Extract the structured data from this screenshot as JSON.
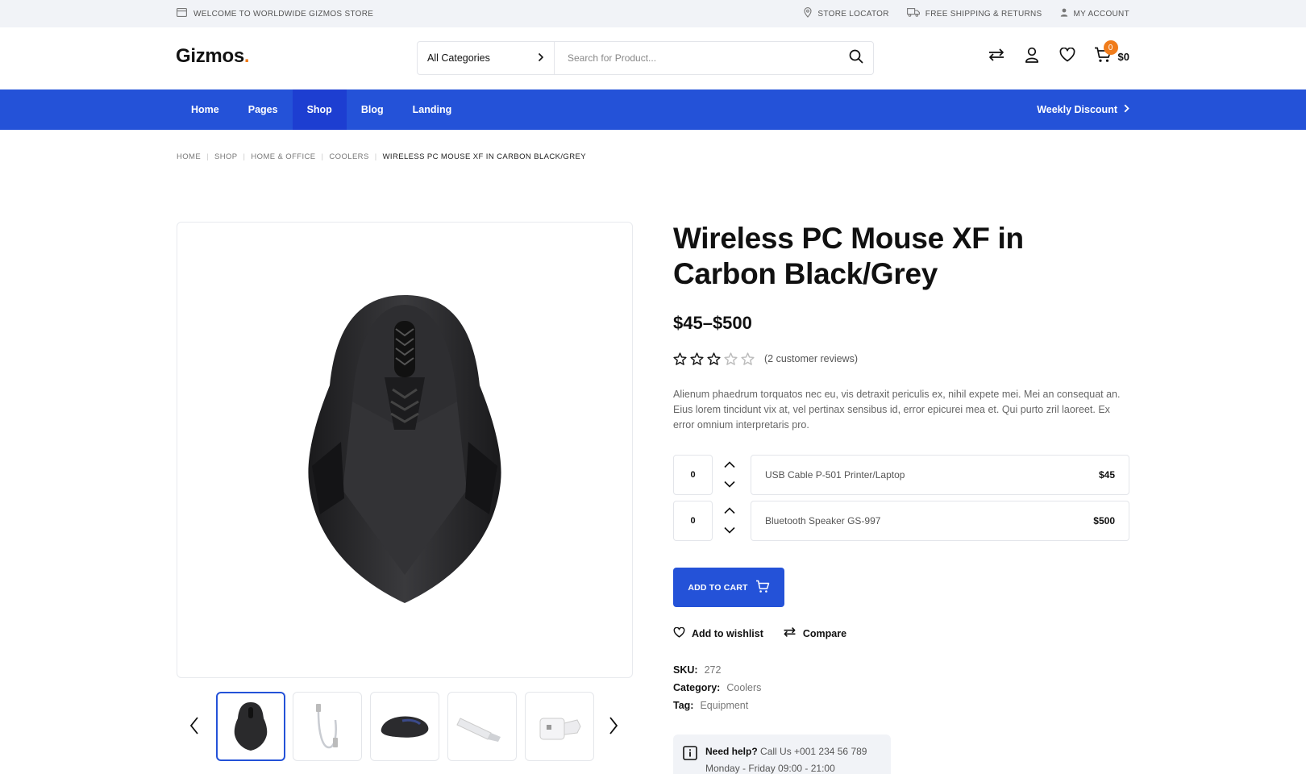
{
  "topbar": {
    "welcome": "WELCOME TO WORLDWIDE GIZMOS STORE",
    "store_locator": "STORE LOCATOR",
    "shipping": "FREE SHIPPING & RETURNS",
    "account": "MY ACCOUNT"
  },
  "header": {
    "logo_text": "Gizmos",
    "logo_dot": ".",
    "category_label": "All Categories",
    "search_placeholder": "Search for Product...",
    "cart_count": "0",
    "cart_total": "$0"
  },
  "nav": {
    "items": [
      {
        "label": "Home"
      },
      {
        "label": "Pages"
      },
      {
        "label": "Shop"
      },
      {
        "label": "Blog"
      },
      {
        "label": "Landing"
      }
    ],
    "active": "Shop",
    "weekly": "Weekly Discount"
  },
  "breadcrumb": [
    "HOME",
    "SHOP",
    "HOME & OFFICE",
    "COOLERS",
    "WIRELESS PC MOUSE XF IN CARBON BLACK/GREY"
  ],
  "product": {
    "title": "Wireless PC Mouse XF in Carbon Black/Grey",
    "price": "$45–$500",
    "rating": 3,
    "rating_max": 5,
    "reviews": "(2 customer reviews)",
    "description": "Alienum phaedrum torquatos nec eu, vis detraxit periculis ex, nihil expete mei. Mei an consequat an. Eius lorem tincidunt vix at, vel pertinax sensibus id, error epicurei mea et. Qui purto zril laoreet. Ex error omnium interpretaris pro.",
    "grouped": [
      {
        "qty": "0",
        "name": "USB Cable P-501 Printer/Laptop",
        "price": "$45"
      },
      {
        "qty": "0",
        "name": "Bluetooth Speaker GS-997",
        "price": "$500"
      }
    ],
    "add_to_cart": "ADD TO CART",
    "wishlist": "Add to wishlist",
    "compare": "Compare",
    "sku_label": "SKU:",
    "sku": "272",
    "category_label": "Category:",
    "category": "Coolers",
    "tag_label": "Tag:",
    "tag": "Equipment"
  },
  "help": {
    "title": "Need help?",
    "phone": "Call Us +001 234 56 789",
    "hours": "Monday - Friday 09:00 - 21:00"
  },
  "colors": {
    "accent": "#2452d8",
    "accent_dark": "#1d3ed1",
    "orange": "#f07c1b",
    "topbar_bg": "#f1f3f7"
  },
  "icons": {
    "welcome": "card-icon",
    "store": "location-pin-icon",
    "shipping": "truck-icon",
    "account": "user-icon",
    "compare": "arrows-swap-icon",
    "wishlist": "heart-icon",
    "cart": "cart-icon",
    "search": "search-icon",
    "help": "info-icon"
  }
}
